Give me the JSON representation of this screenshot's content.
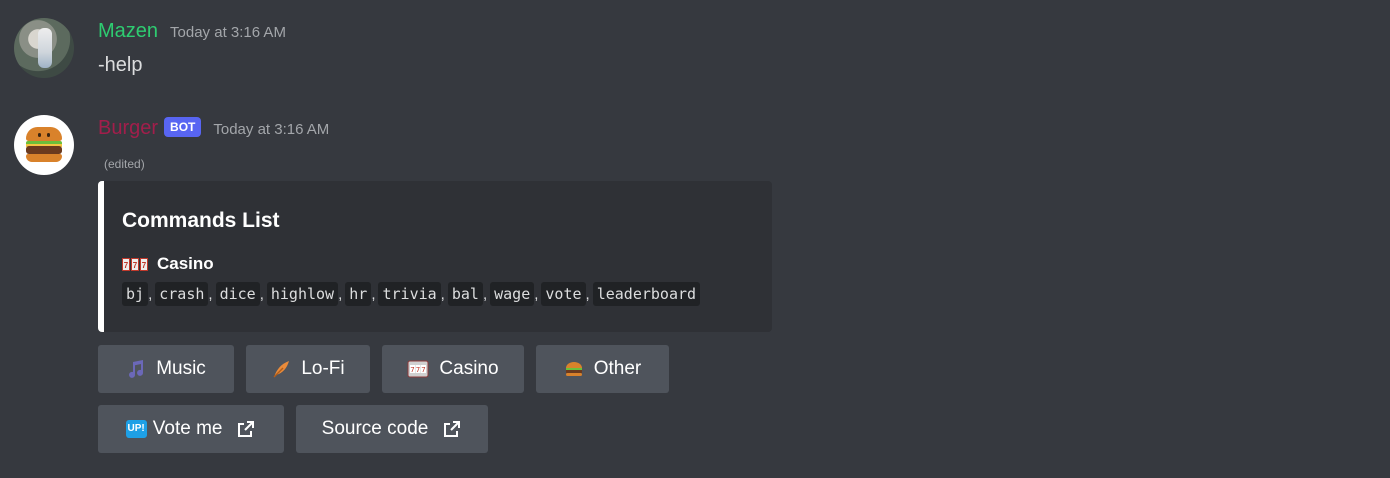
{
  "messages": [
    {
      "author": "Mazen",
      "timestamp": "Today at 3:16 AM",
      "content": "-help",
      "author_color": "#2ecc71"
    },
    {
      "author": "Burger",
      "badge": "BOT",
      "timestamp": "Today at 3:16 AM",
      "edited": "(edited)",
      "author_color": "#a21e4b",
      "embed": {
        "title": "Commands List",
        "field_name": "Casino",
        "field_icon": "slot-machine-icon",
        "commands": [
          "bj",
          "crash",
          "dice",
          "highlow",
          "hr",
          "trivia",
          "bal",
          "wage",
          "vote",
          "leaderboard"
        ]
      },
      "buttons_row1": [
        {
          "label": "Music",
          "icon": "music-note-icon"
        },
        {
          "label": "Lo-Fi",
          "icon": "feather-icon"
        },
        {
          "label": "Casino",
          "icon": "slot-machine-icon"
        },
        {
          "label": "Other",
          "icon": "burger-icon"
        }
      ],
      "buttons_row2": [
        {
          "label": "Vote me",
          "icon": "up-badge-icon",
          "badge_text": "UP!",
          "external": true
        },
        {
          "label": "Source code",
          "external": true
        }
      ]
    }
  ],
  "colors": {
    "background": "#36393f",
    "embed_background": "#2f3136",
    "button": "#4f545c",
    "bot_badge": "#5865f2"
  }
}
